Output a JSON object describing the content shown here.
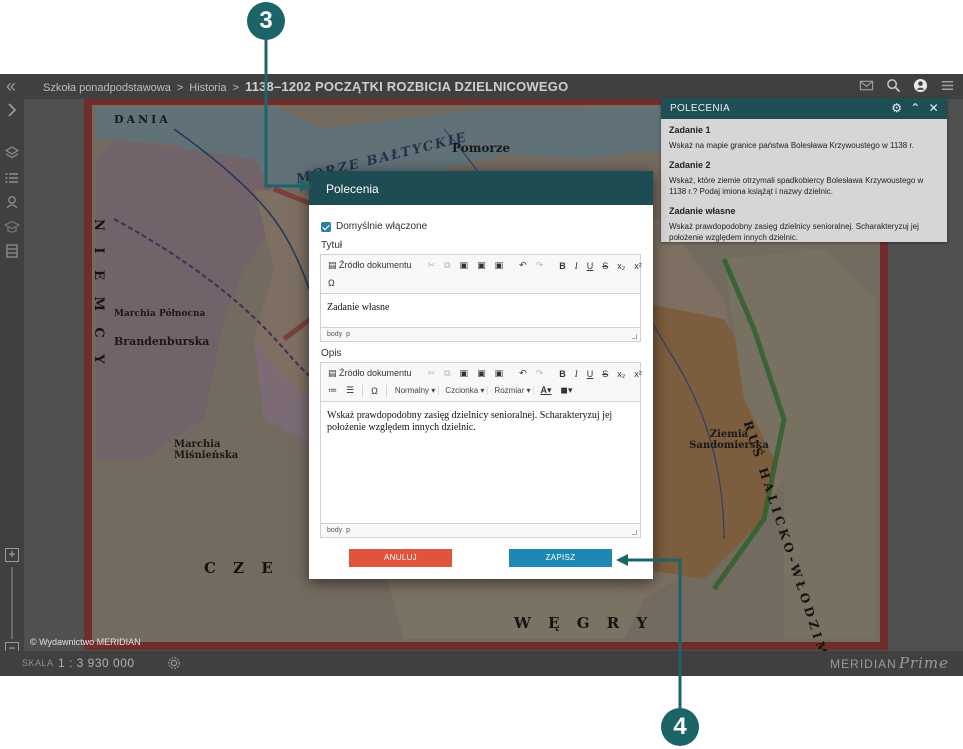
{
  "breadcrumb": {
    "items": [
      "Szkoła ponadpodstawowa",
      "Historia"
    ],
    "separator": ">",
    "current": "1138–1202 POCZĄTKI ROZBICIA DZIELNICOWEGO"
  },
  "toolbar_icons": [
    "mail-icon",
    "search-icon",
    "user-icon",
    "menu-icon"
  ],
  "sidebar_icons": [
    "chevron-right-icon",
    "layers-icon",
    "list-icon",
    "map-marker-icon",
    "graduation-icon",
    "book-icon"
  ],
  "map": {
    "labels": {
      "dania": "DANIA",
      "sea": "MORZE BAŁTYCKIE",
      "pomorze": "Pomorze",
      "ziemia": "Ziemia Sandomierska",
      "marchia_polnocna": "Marchia Północna",
      "brandenburska": "Brandenburska",
      "marchia_misn": "Marchia Miśnieńska",
      "halicko": "RUŚ HALICKO-WŁODZIMIERSKA",
      "czechy": "C Z E",
      "wegry": "W Ę G R Y",
      "rzesza": "N I E M C Y"
    },
    "copyright": "© Wydawnictwo MERIDIAN"
  },
  "bottom": {
    "scale_label": "SKALA",
    "scale_value": "1 : 3 930 000",
    "brand": "MERIDIAN",
    "brand_suffix": "Prime"
  },
  "panel": {
    "title": "POLECENIA",
    "tasks": [
      {
        "title": "Zadanie 1",
        "text": "Wskaż na mapie granice państwa Bolesława Krzywoustego w 1138 r."
      },
      {
        "title": "Zadanie 2",
        "text": "Wskaż, które ziemie otrzymali spadkobiercy Bolesława Krzywoustego w 1138 r.? Podaj imiona książąt i nazwy dzielnic."
      },
      {
        "title": "Zadanie własne",
        "text": "Wskaż prawdopodobny zasięg dzielnicy senioralnej. Scharakteryzuj jej położenie względem innych dzielnic."
      }
    ]
  },
  "modal": {
    "title": "Polecenia",
    "checkbox_label": "Domyślnie włączone",
    "checkbox_checked": true,
    "title_field_label": "Tytuł",
    "title_value": "Zadanie własne",
    "desc_field_label": "Opis",
    "desc_value": "Wskaż prawdopodobny zasięg dzielnicy senioralnej. Scharakteryzuj jej położenie względem innych dzielnic.",
    "source_btn": "Źródło dokumentu",
    "format_combo": "Normalny",
    "font_combo": "Czcionka",
    "size_combo": "Rozmiar",
    "path_body": "body",
    "path_p": "p",
    "cancel_label": "ANULUJ",
    "save_label": "ZAPISZ"
  },
  "callouts": {
    "top": "3",
    "bottom": "4"
  },
  "colors": {
    "accent": "#1d4c52",
    "save": "#1e88b4",
    "cancel": "#e0533d",
    "callout": "#1c6468"
  }
}
